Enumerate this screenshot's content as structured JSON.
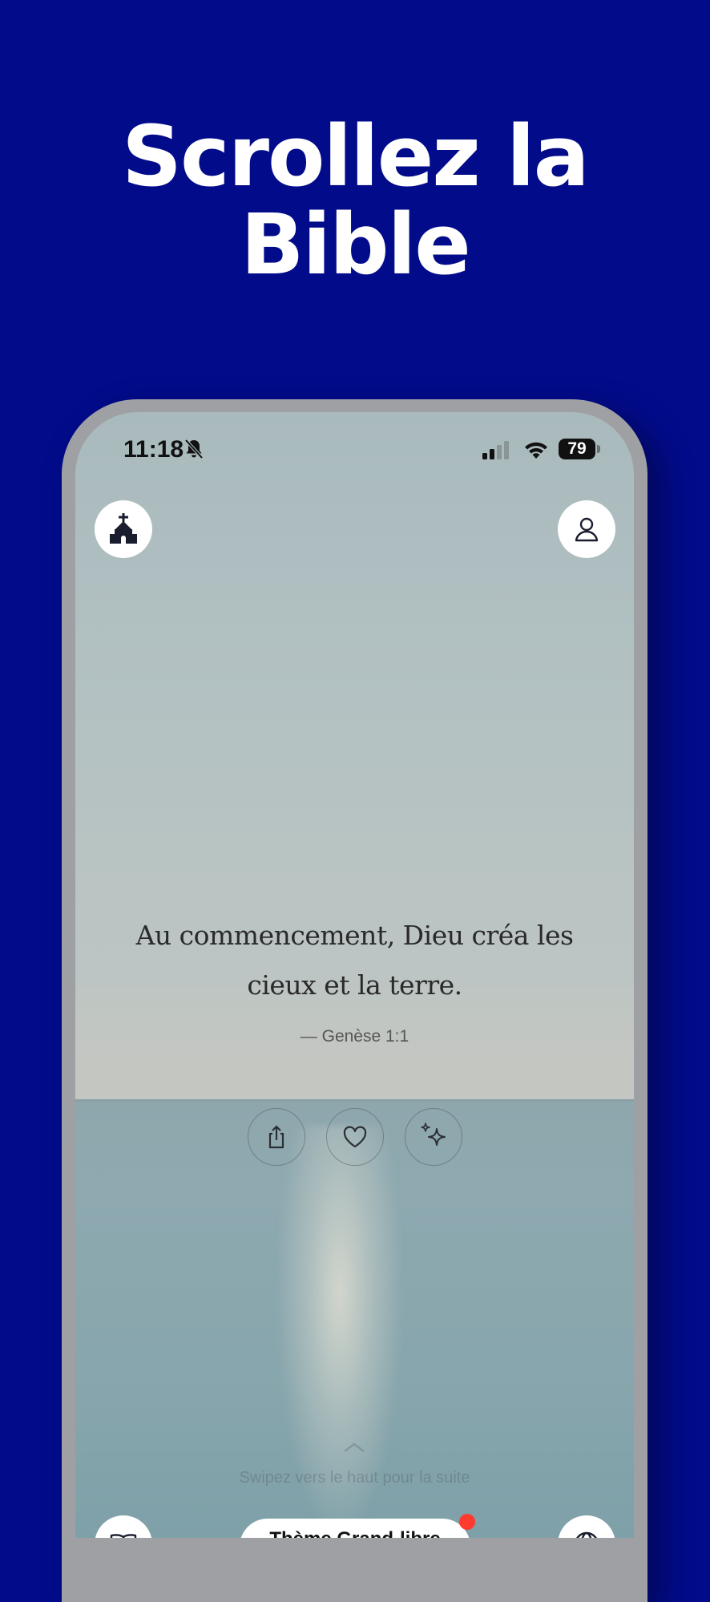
{
  "headline": {
    "line1": "Scrollez la",
    "line2": "Bible"
  },
  "status_bar": {
    "time": "11:18",
    "battery": "79",
    "icons": [
      "bell-off-icon",
      "signal-icon",
      "wifi-icon",
      "battery-icon"
    ]
  },
  "top_buttons": {
    "left_icon": "church-icon",
    "right_icon": "person-icon"
  },
  "verse": {
    "text": "Au commencement, Dieu créa les cieux et la terre.",
    "reference": "— Genèse 1:1"
  },
  "actions": [
    {
      "icon": "share-icon"
    },
    {
      "icon": "heart-icon"
    },
    {
      "icon": "sparkles-icon"
    }
  ],
  "swipe_hint": "Swipez vers le haut pour la suite",
  "bottom_bar": {
    "left_icon": "book-icon",
    "right_icon": "globe-icon",
    "pill_label": "Thème Grand-libre",
    "notification_color": "#ff3b30"
  },
  "colors": {
    "background": "#020b8a",
    "headline": "#ffffff"
  }
}
